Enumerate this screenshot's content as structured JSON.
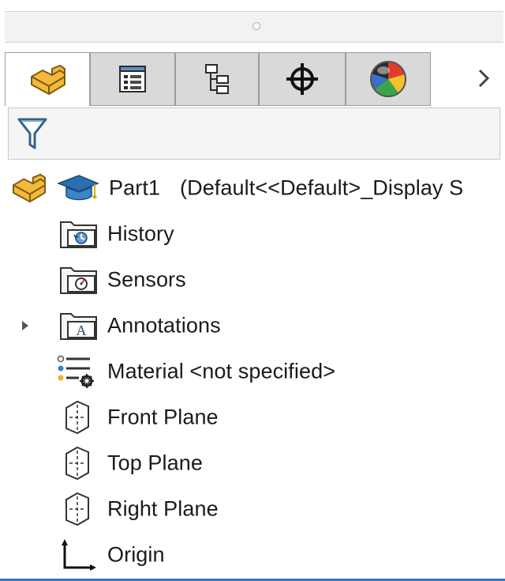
{
  "panel": {
    "tabs": [
      {
        "icon": "featuremanager-part-icon",
        "active": true
      },
      {
        "icon": "propertymanager-icon",
        "active": false
      },
      {
        "icon": "configurationmanager-icon",
        "active": false
      },
      {
        "icon": "dimxpertmanager-icon",
        "active": false
      },
      {
        "icon": "displaymanager-icon",
        "active": false
      }
    ],
    "more_tabs_icon": "chevron-right-icon",
    "filter_icon": "funnel-filter-icon"
  },
  "tree": {
    "root": {
      "name": "Part1",
      "config": "(Default<<Default>_Display S"
    },
    "items": [
      {
        "label": "History",
        "icon": "history-folder-icon"
      },
      {
        "label": "Sensors",
        "icon": "sensors-folder-icon"
      },
      {
        "label": "Annotations",
        "icon": "annotations-folder-icon",
        "expandable": true
      },
      {
        "label": "Material <not specified>",
        "icon": "material-icon"
      },
      {
        "label": "Front Plane",
        "icon": "plane-icon"
      },
      {
        "label": "Top Plane",
        "icon": "plane-icon"
      },
      {
        "label": "Right Plane",
        "icon": "plane-icon"
      },
      {
        "label": "Origin",
        "icon": "origin-icon"
      }
    ]
  },
  "colors": {
    "part_icon": "#f2b73a",
    "accent_blue": "#2f79c4"
  }
}
